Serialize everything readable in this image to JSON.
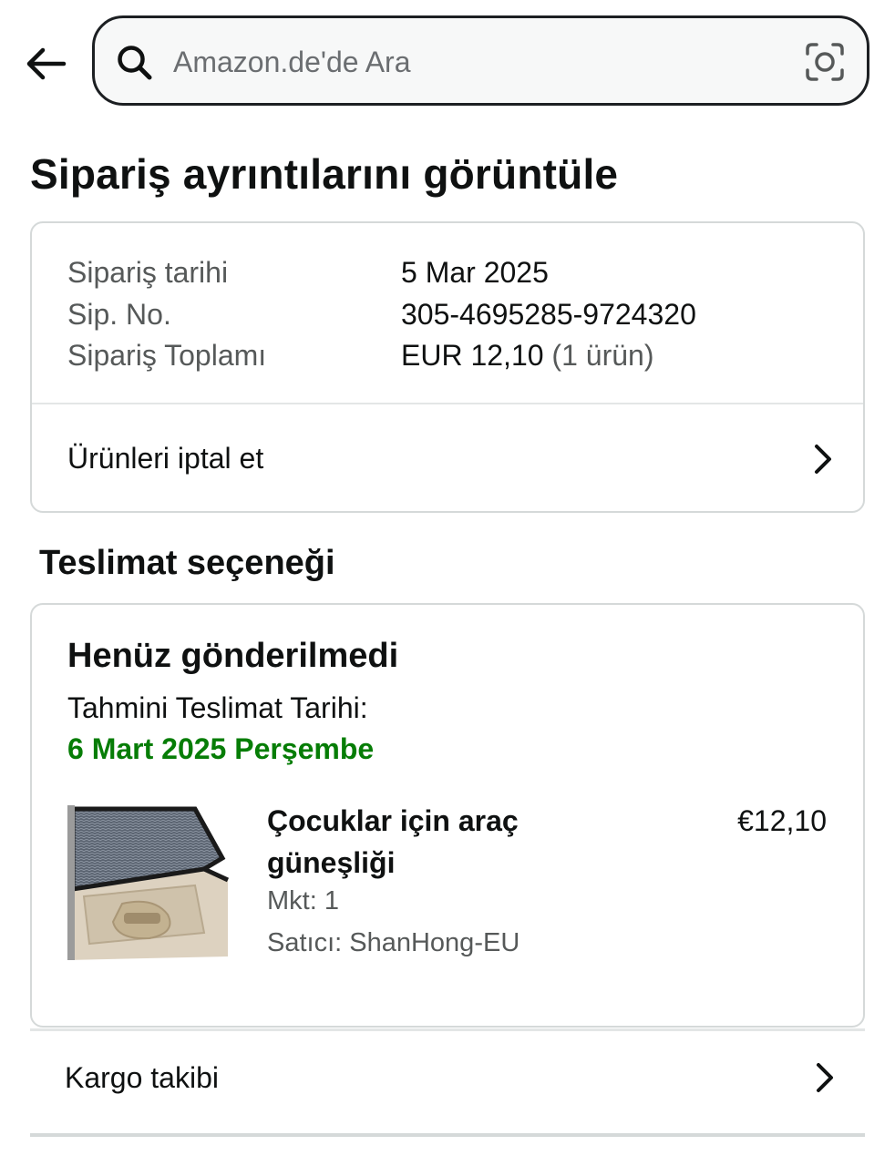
{
  "header": {
    "search_placeholder": "Amazon.de'de Ara"
  },
  "page_title": "Sipariş ayrıntılarını görüntüle",
  "order_summary": {
    "rows": [
      {
        "label": "Sipariş tarihi",
        "value": "5 Mar 2025",
        "extra": ""
      },
      {
        "label": "Sip. No.",
        "value": "305-4695285-9724320",
        "extra": ""
      },
      {
        "label": "Sipariş Toplamı",
        "value": "EUR 12,10",
        "extra": "(1 ürün)"
      }
    ],
    "cancel_label": "Ürünleri iptal et"
  },
  "delivery": {
    "section_title": "Teslimat seçeneği",
    "status": "Henüz gönderilmedi",
    "eta_label": "Tahmini Teslimat Tarihi:",
    "eta_date": "6 Mart 2025 Perşembe",
    "eta_color": "#067d06",
    "product": {
      "title": "Çocuklar için araç güneşliği",
      "price": "€12,10",
      "quantity": "Mkt: 1",
      "seller": "Satıcı: ShanHong-EU",
      "image_icon": "car-window-sunshade-image"
    }
  },
  "tracking": {
    "label": "Kargo takibi"
  },
  "icons": {
    "back": "arrow-left-icon",
    "search": "search-icon",
    "camera": "camera-lens-icon",
    "chevron": "chevron-right-icon"
  }
}
